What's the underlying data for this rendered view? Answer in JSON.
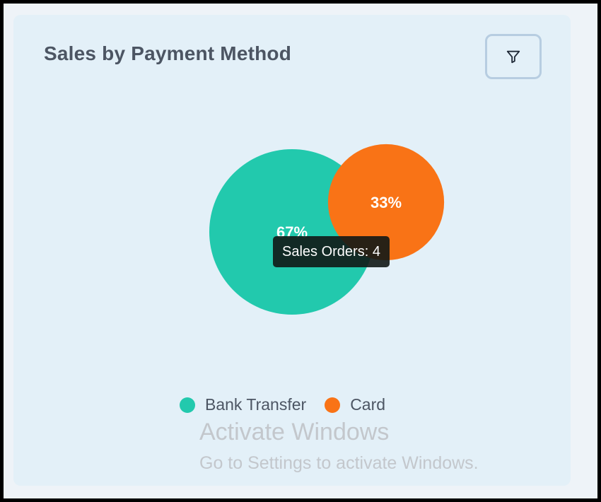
{
  "widget": {
    "title": "Sales by Payment Method",
    "filter_icon": "filter-icon",
    "tooltip": "Sales Orders: 4"
  },
  "colors": {
    "card_background": "#e3f0f8",
    "bank_transfer": "#22c9ad",
    "card": "#f97316",
    "title_text": "#4c5563"
  },
  "chart_data": {
    "type": "pie",
    "title": "Sales by Payment Method",
    "categories": [
      "Bank Transfer",
      "Card"
    ],
    "values": [
      67,
      33
    ],
    "labels": [
      "67%",
      "33%"
    ],
    "colors": [
      "#22c9ad",
      "#f97316"
    ],
    "legend_position": "bottom-center",
    "tooltip": "Sales Orders: 4"
  },
  "legend": [
    {
      "label": "Bank Transfer",
      "color": "#22c9ad"
    },
    {
      "label": "Card",
      "color": "#f97316"
    }
  ],
  "watermark": {
    "title": "Activate Windows",
    "subtitle": "Go to Settings to activate Windows."
  }
}
